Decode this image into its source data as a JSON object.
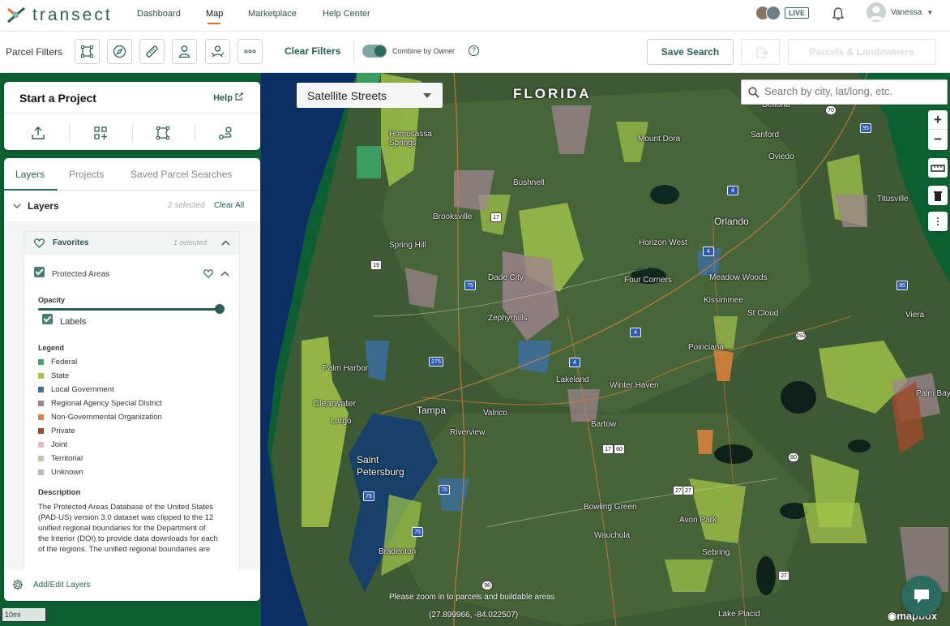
{
  "app": {
    "logo_text": "transect"
  },
  "nav": {
    "links": [
      "Dashboard",
      "Map",
      "Marketplace",
      "Help Center"
    ],
    "live_label": "LIVE",
    "user_name": "Vanessa"
  },
  "filterbar": {
    "title": "Parcel Filters",
    "clear_filters": "Clear Filters",
    "combine_label": "Combine by Owner",
    "combine_on": true,
    "help_glyph": "?",
    "save_search": "Save Search",
    "parcels_landowners": "Parcels & Landowners",
    "filter_icons": [
      "parcel-shape-icon",
      "compass-icon",
      "ruler-icon",
      "person-icon",
      "people-icon",
      "more-icon"
    ]
  },
  "map": {
    "style_select": "Satellite Streets",
    "search_placeholder": "Search by city, lat/long, etc.",
    "region_label": "FLORIDA",
    "zoom_in": "+",
    "zoom_out": "−",
    "scale": "10mi",
    "zoom_hint": "Please zoom in to parcels and buildable areas",
    "coordinates": "(27.899966, -84.022507)",
    "attribution": "mapbox",
    "places": [
      "Deltona",
      "Sanford",
      "Mount Dora",
      "Oviedo",
      "Titusville",
      "Homosassa Springs",
      "Bushnell",
      "Brooksville",
      "Orlando",
      "Horizon West",
      "Spring Hill",
      "Dade City",
      "Four Corners",
      "Meadow Woods",
      "Kissimmee",
      "St Cloud",
      "Zephyrhills",
      "Viera",
      "Palm Harbor",
      "Poinciana",
      "Lakeland",
      "Winter Haven",
      "Clearwater",
      "Largo",
      "Tampa",
      "Valrico",
      "Palm Bay",
      "Riverview",
      "Bartow",
      "Saint Petersburg",
      "Bowling Green",
      "Avon Park",
      "Wauchula",
      "Sebring",
      "Bradenton",
      "Lake Placid"
    ],
    "shields": [
      "95",
      "4",
      "19",
      "75",
      "4",
      "4",
      "275",
      "4",
      "192",
      "75",
      "60",
      "17",
      "27",
      "75",
      "75",
      "98",
      "27",
      "70",
      "95",
      "27",
      "60",
      "17"
    ]
  },
  "project": {
    "title": "Start a Project",
    "help": "Help"
  },
  "layers": {
    "tabs": [
      "Layers",
      "Projects",
      "Saved Parcel Searches"
    ],
    "heading": "Layers",
    "selected": "2 selected",
    "clear_all": "Clear All",
    "favorites_label": "Favorites",
    "favorites_selected": "1 selected",
    "layer_name": "Protected Areas",
    "opacity_label": "Opacity",
    "opacity_value": 1.0,
    "labels_label": "Labels",
    "legend_title": "Legend",
    "legend": [
      {
        "label": "Federal",
        "color": "#3aa86a"
      },
      {
        "label": "State",
        "color": "#a3c64a"
      },
      {
        "label": "Local Government",
        "color": "#3c6fa8"
      },
      {
        "label": "Regional Agency Special District",
        "color": "#a0858f"
      },
      {
        "label": "Non-Governmental Organization",
        "color": "#e0813c"
      },
      {
        "label": "Private",
        "color": "#9b4b2c"
      },
      {
        "label": "Joint",
        "color": "#e9b9c0"
      },
      {
        "label": "Territorial",
        "color": "#c9c2ab"
      },
      {
        "label": "Unknown",
        "color": "#b8b8b8"
      }
    ],
    "description_title": "Description",
    "description": "The Protected Areas Database of the United States (PAD-US) version 3.0 dataset was clipped to the 12 unified regional boundaries for the Department of the Interior (DOI) to provide data downloads for each of the regions. The unified regional boundaries are",
    "add_edit": "Add/Edit Layers"
  }
}
